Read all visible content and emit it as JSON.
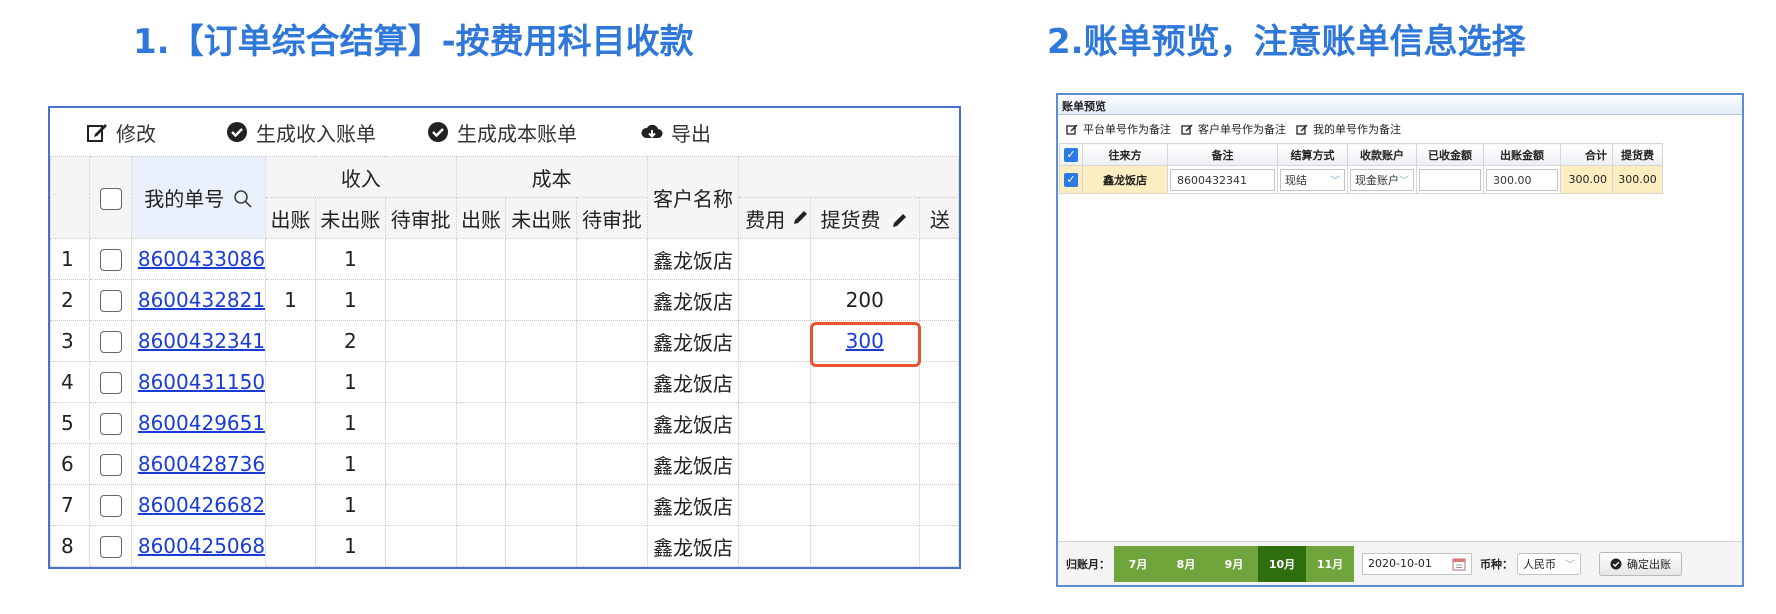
{
  "headings": {
    "left": "1.【订单综合结算】-按费用科目收款",
    "right": "2.账单预览，注意账单信息选择"
  },
  "grid": {
    "toolbar": {
      "edit": "修改",
      "gen_income": "生成收入账单",
      "gen_cost": "生成成本账单",
      "export": "导出"
    },
    "headers": {
      "my_order_no": "我的单号",
      "income": "收入",
      "cost": "成本",
      "billed": "出账",
      "unbilled": "未出账",
      "pending": "待审批",
      "customer": "客户名称",
      "fee_partial": "费用",
      "pickup_fee": "提货费",
      "next_partial": "送"
    },
    "rows": [
      {
        "n": "1",
        "order": "8600433086",
        "inc_billed": "",
        "inc_unbilled": "1",
        "customer": "鑫龙饭店",
        "pickup": ""
      },
      {
        "n": "2",
        "order": "8600432821",
        "inc_billed": "1",
        "inc_unbilled": "1",
        "customer": "鑫龙饭店",
        "pickup": "200"
      },
      {
        "n": "3",
        "order": "8600432341",
        "inc_billed": "",
        "inc_unbilled": "2",
        "customer": "鑫龙饭店",
        "pickup": "300"
      },
      {
        "n": "4",
        "order": "8600431150",
        "inc_billed": "",
        "inc_unbilled": "1",
        "customer": "鑫龙饭店",
        "pickup": ""
      },
      {
        "n": "5",
        "order": "8600429651",
        "inc_billed": "",
        "inc_unbilled": "1",
        "customer": "鑫龙饭店",
        "pickup": ""
      },
      {
        "n": "6",
        "order": "8600428736",
        "inc_billed": "",
        "inc_unbilled": "1",
        "customer": "鑫龙饭店",
        "pickup": ""
      },
      {
        "n": "7",
        "order": "8600426682",
        "inc_billed": "",
        "inc_unbilled": "1",
        "customer": "鑫龙饭店",
        "pickup": ""
      },
      {
        "n": "8",
        "order": "8600425068",
        "inc_billed": "",
        "inc_unbilled": "1",
        "customer": "鑫龙饭店",
        "pickup": ""
      }
    ]
  },
  "preview": {
    "title": "账单预览",
    "options": [
      "平台单号作为备注",
      "客户单号作为备注",
      "我的单号作为备注"
    ],
    "headers": {
      "counterparty": "往来方",
      "remark": "备注",
      "settle_method": "结算方式",
      "account": "收款账户",
      "received": "已收金额",
      "bill_amount": "出账金额",
      "total": "合计",
      "pickup_fee": "提货费"
    },
    "row": {
      "counterparty": "鑫龙饭店",
      "remark": "8600432341",
      "settle_method": "现结",
      "account": "现金账户",
      "received": "",
      "bill_amount": "300.00",
      "total": "300.00",
      "pickup_fee": "300.00"
    },
    "footer": {
      "period_label": "归账月：",
      "months": [
        "7月",
        "8月",
        "9月",
        "10月",
        "11月"
      ],
      "active_month": "10月",
      "date": "2020-10-01",
      "currency_label": "币种：",
      "currency": "人民币",
      "confirm": "确定出账"
    }
  },
  "colors": {
    "heading": "#2f77d8",
    "link": "#1a3cd6",
    "highlight_box": "#e9532e",
    "month_bar": "#6fa53b",
    "month_active": "#2f6e0f",
    "amount_cell": "#fdeec2"
  },
  "icons": {
    "edit": "edit-icon",
    "check_circle": "check-circle-icon",
    "cloud_download": "cloud-download-icon",
    "search": "search-icon",
    "pencil": "pencil-icon",
    "calendar": "calendar-icon"
  }
}
